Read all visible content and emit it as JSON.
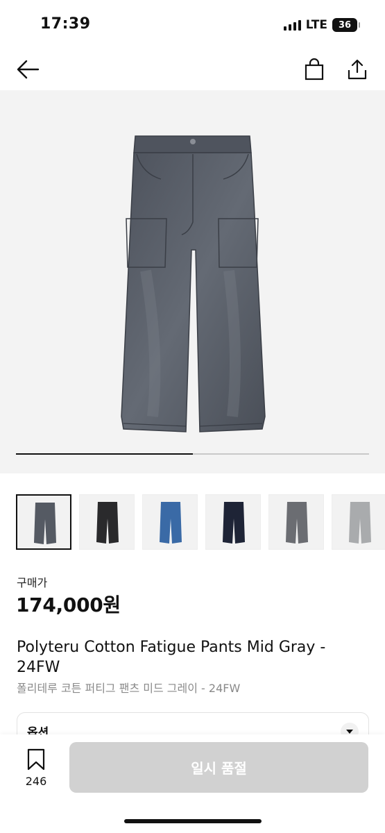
{
  "status_bar": {
    "time": "17:39",
    "network": "LTE",
    "battery": "36",
    "icons": [
      "signal-icon",
      "battery-icon"
    ]
  },
  "nav": {
    "icons": [
      "back-arrow-icon",
      "shopping-bag-icon",
      "share-icon"
    ]
  },
  "hero": {
    "image": "gray-wide-fatigue-pants",
    "carousel_progress": 0.5
  },
  "thumbnails": [
    {
      "color": "mid-gray",
      "selected": true
    },
    {
      "color": "black",
      "selected": false
    },
    {
      "color": "blue",
      "selected": false
    },
    {
      "color": "navy",
      "selected": false
    },
    {
      "color": "gray",
      "selected": false
    },
    {
      "color": "light-gray",
      "selected": false
    }
  ],
  "price": {
    "label": "구매가",
    "value": "174,000원"
  },
  "product": {
    "title_en": "Polyteru Cotton Fatigue Pants Mid Gray - 24FW",
    "title_kr": "폴리테루 코튼 퍼티그 팬츠 미드 그레이 - 24FW"
  },
  "option": {
    "label": "옵션",
    "icon": "chevron-down-icon"
  },
  "bottom_bar": {
    "wishlist_count": "246",
    "wishlist_icon": "bookmark-icon",
    "soldout_label": "일시 품절"
  },
  "colors": {
    "pants_mid_gray": "#555a63",
    "button_disabled": "#d1d1d1",
    "hero_bg": "#f3f3f3"
  }
}
